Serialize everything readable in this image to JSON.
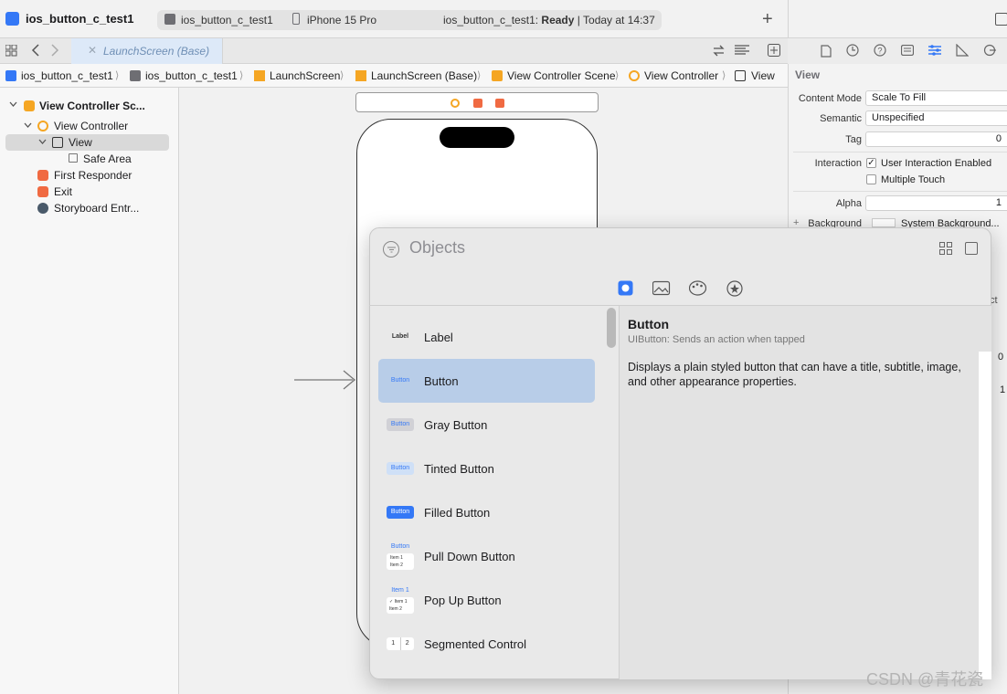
{
  "toolbar": {
    "project_title": "ios_button_c_test1",
    "scheme": "ios_button_c_test1",
    "destination": "iPhone 15 Pro",
    "status_project": "ios_button_c_test1:",
    "status_state": "Ready",
    "status_time": "| Today at 14:37",
    "add_label": "+"
  },
  "tab": {
    "label": "LaunchScreen (Base)",
    "close": "✕"
  },
  "jumpbar": {
    "items": [
      "ios_button_c_test1",
      "ios_button_c_test1",
      "LaunchScreen",
      "LaunchScreen (Base)",
      "View Controller Scene",
      "View Controller",
      "View"
    ],
    "sep": "⟩"
  },
  "outline": {
    "items": [
      {
        "label": "View Controller Sc...",
        "icon": "scene-icon"
      },
      {
        "label": "View Controller",
        "icon": "view-controller-icon"
      },
      {
        "label": "View",
        "icon": "view-icon"
      },
      {
        "label": "Safe Area",
        "icon": "safe-area-icon"
      },
      {
        "label": "First Responder",
        "icon": "first-responder-icon"
      },
      {
        "label": "Exit",
        "icon": "exit-icon"
      },
      {
        "label": "Storyboard Entr...",
        "icon": "storyboard-entry-icon"
      }
    ]
  },
  "inspector": {
    "header": "View",
    "content_mode_label": "Content Mode",
    "content_mode_value": "Scale To Fill",
    "semantic_label": "Semantic",
    "semantic_value": "Unspecified",
    "tag_label": "Tag",
    "tag_value": "0",
    "interaction_label": "Interaction",
    "user_interaction_label": "User Interaction Enabled",
    "multiple_touch_label": "Multiple Touch",
    "alpha_label": "Alpha",
    "alpha_value": "1",
    "background_label": "Background",
    "background_value": "System Background...",
    "partial_text": "ct",
    "partial_value_1": "0",
    "partial_value_2": "1"
  },
  "library": {
    "search_placeholder": "Objects",
    "items": [
      {
        "name": "Label",
        "thumb": "Label"
      },
      {
        "name": "Button",
        "thumb": "Button"
      },
      {
        "name": "Gray Button",
        "thumb": "Button"
      },
      {
        "name": "Tinted Button",
        "thumb": "Button"
      },
      {
        "name": "Filled Button",
        "thumb": "Button"
      },
      {
        "name": "Pull Down Button",
        "thumb": "Button",
        "thumb_sub1": "Item 1",
        "thumb_sub2": "Item 2"
      },
      {
        "name": "Pop Up Button",
        "thumb": "Item 1",
        "thumb_sub1": "✓ Item 1",
        "thumb_sub2": "Item 2"
      },
      {
        "name": "Segmented Control",
        "thumb": "1",
        "thumb2": "2"
      }
    ],
    "detail": {
      "title": "Button",
      "subtitle": "UIButton: Sends an action when tapped",
      "description": "Displays a plain styled button that can have a title, subtitle, image, and other appearance properties."
    }
  },
  "watermark": "CSDN @青花瓷",
  "colors": {
    "accent": "#3478f6",
    "selection": "#b8cde8",
    "orange": "#f5a623",
    "red": "#f06a42"
  }
}
